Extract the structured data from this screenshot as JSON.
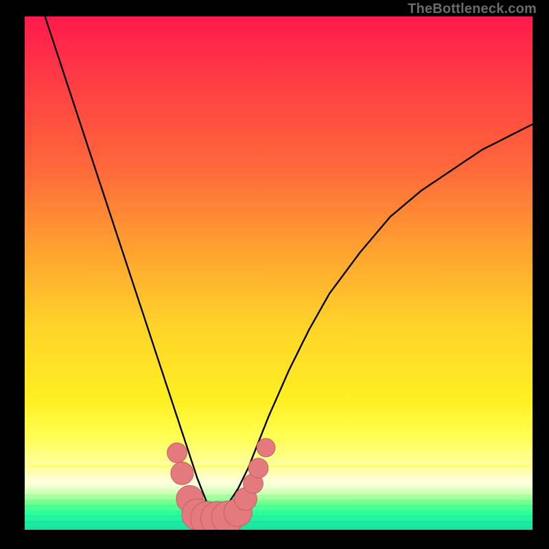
{
  "watermark": "TheBottleneck.com",
  "colors": {
    "frame": "#000000",
    "curve": "#000000",
    "marker_fill": "#e37b7e",
    "marker_stroke": "#c95d60"
  },
  "chart_data": {
    "type": "line",
    "title": "",
    "xlabel": "",
    "ylabel": "",
    "xlim": [
      0,
      100
    ],
    "ylim": [
      0,
      100
    ],
    "grid": false,
    "background": "red-orange-yellow-green vertical gradient (high=red top, low=green bottom)",
    "series": [
      {
        "name": "bottleneck-curve",
        "description": "Two convex branches meeting at a minimum near x≈37. Left branch from top-left descending steeply; right branch rising toward upper-right with decreasing slope.",
        "x": [
          4,
          8,
          12,
          16,
          20,
          24,
          26,
          28,
          30,
          32,
          34,
          36,
          37,
          38,
          40,
          42,
          44,
          46,
          48,
          52,
          56,
          60,
          66,
          72,
          78,
          84,
          90,
          96,
          100
        ],
        "y": [
          100,
          88,
          76,
          64,
          52,
          40,
          34,
          28,
          22,
          16,
          10,
          5,
          3,
          3,
          5,
          8,
          12,
          17,
          22,
          31,
          39,
          46,
          54,
          61,
          66,
          70,
          74,
          77,
          79
        ]
      }
    ],
    "markers": {
      "name": "highlighted-points",
      "shape": "circle",
      "color": "#e37b7e",
      "points": [
        {
          "x": 30,
          "y": 15,
          "r": 1.1
        },
        {
          "x": 31,
          "y": 11,
          "r": 1.3
        },
        {
          "x": 32.5,
          "y": 6,
          "r": 1.6
        },
        {
          "x": 34,
          "y": 3,
          "r": 1.9
        },
        {
          "x": 36,
          "y": 2.2,
          "r": 2.1
        },
        {
          "x": 38,
          "y": 2.2,
          "r": 2.1
        },
        {
          "x": 40,
          "y": 2.4,
          "r": 2.0
        },
        {
          "x": 42,
          "y": 3.4,
          "r": 1.7
        },
        {
          "x": 43.5,
          "y": 6,
          "r": 1.3
        },
        {
          "x": 45,
          "y": 9,
          "r": 1.1
        },
        {
          "x": 46,
          "y": 12,
          "r": 1.1
        },
        {
          "x": 47.5,
          "y": 16,
          "r": 1.0
        }
      ]
    }
  }
}
